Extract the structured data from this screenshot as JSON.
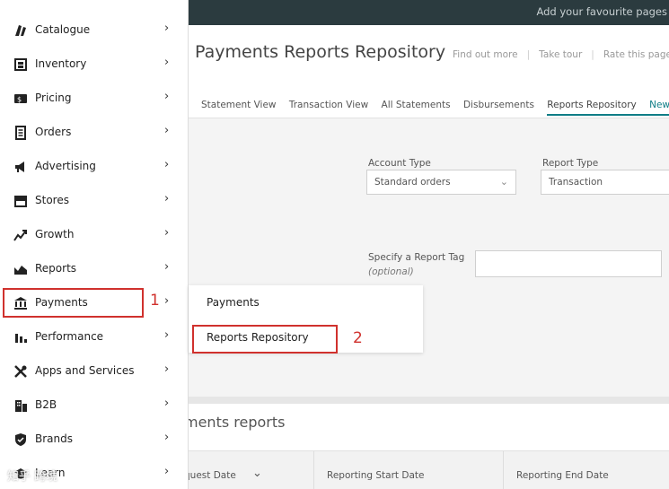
{
  "topbar": {
    "favourite_text": "Add your favourite pages"
  },
  "page": {
    "title": "Payments Reports Repository",
    "links": [
      "Find out more",
      "Take tour",
      "Rate this page"
    ],
    "tabs": [
      "Statement View",
      "Transaction View",
      "All Statements",
      "Disbursements"
    ],
    "active_tab": "Reports Repository",
    "active_tab_badge": "New",
    "account_type_label": "Account Type",
    "account_type_value": "Standard orders",
    "report_type_label": "Report Type",
    "report_type_value": "Transaction",
    "report_tag_label": "Specify a Report Tag",
    "report_tag_optional": "(optional)",
    "section_title": "ments reports",
    "table_headers": [
      "quest Date",
      "Reporting Start Date",
      "Reporting End Date"
    ]
  },
  "sidebar": {
    "items": [
      {
        "label": "Catalogue",
        "icon": "catalogue-icon"
      },
      {
        "label": "Inventory",
        "icon": "inventory-icon"
      },
      {
        "label": "Pricing",
        "icon": "pricing-icon"
      },
      {
        "label": "Orders",
        "icon": "orders-icon"
      },
      {
        "label": "Advertising",
        "icon": "advertising-icon"
      },
      {
        "label": "Stores",
        "icon": "stores-icon"
      },
      {
        "label": "Growth",
        "icon": "growth-icon"
      },
      {
        "label": "Reports",
        "icon": "reports-icon"
      },
      {
        "label": "Payments",
        "icon": "bank-icon"
      },
      {
        "label": "Performance",
        "icon": "performance-icon"
      },
      {
        "label": "Apps and Services",
        "icon": "tools-icon"
      },
      {
        "label": "B2B",
        "icon": "b2b-icon"
      },
      {
        "label": "Brands",
        "icon": "brands-icon"
      },
      {
        "label": "Learn",
        "icon": "learn-icon"
      }
    ]
  },
  "submenu": {
    "items": [
      "Payments",
      "Reports Repository"
    ]
  },
  "annotations": {
    "step1": "1",
    "step2": "2",
    "color": "#d0312d"
  },
  "watermark": "知乎 跨境"
}
